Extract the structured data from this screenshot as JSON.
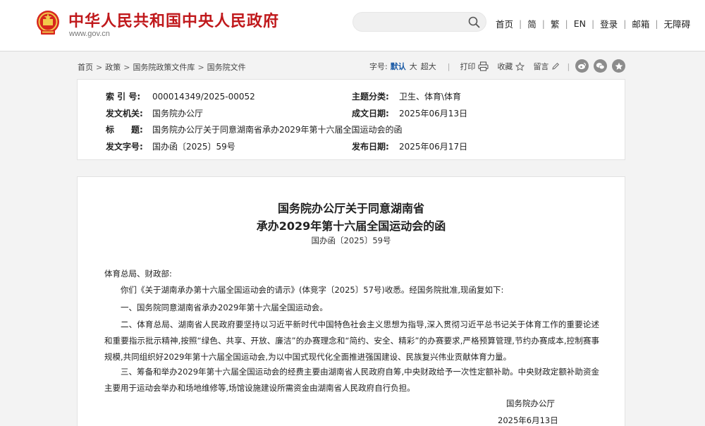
{
  "header": {
    "site_title": "中华人民共和国中央人民政府",
    "site_url": "www.gov.cn",
    "search_placeholder": "",
    "nav": [
      "首页",
      "简",
      "繁",
      "EN",
      "登录",
      "邮箱",
      "无障碍"
    ]
  },
  "breadcrumb": [
    "首页",
    "政策",
    "国务院政策文件库",
    "国务院文件"
  ],
  "tools": {
    "font_label": "字号:",
    "font_sizes": [
      "默认",
      "大",
      "超大"
    ],
    "print": "打印",
    "favorite": "收藏",
    "comment": "留言"
  },
  "colors": {
    "brand_red": "#c0191c",
    "active_blue": "#1a5aa6"
  },
  "info": {
    "index_label": "索 引 号:",
    "index_value": "000014349/2025-00052",
    "topic_label": "主题分类:",
    "topic_value": "卫生、体育\\体育",
    "issuer_label": "发文机关:",
    "issuer_value": "国务院办公厅",
    "date_label": "成文日期:",
    "date_value": "2025年06月13日",
    "title_label": "标　　题:",
    "title_value": "国务院办公厅关于同意湖南省承办2029年第十六届全国运动会的函",
    "docno_label": "发文字号:",
    "docno_value": "国办函〔2025〕59号",
    "pub_label": "发布日期:",
    "pub_value": "2025年06月17日"
  },
  "doc": {
    "title_line1": "国务院办公厅关于同意湖南省",
    "title_line2": "承办2029年第十六届全国运动会的函",
    "doc_no": "国办函〔2025〕59号",
    "salutation": "体育总局、财政部:",
    "p1": "你们《关于湖南承办第十六届全国运动会的请示》(体竞字〔2025〕57号)收悉。经国务院批准,现函复如下:",
    "p2": "一、国务院同意湖南省承办2029年第十六届全国运动会。",
    "p3": "二、体育总局、湖南省人民政府要坚持以习近平新时代中国特色社会主义思想为指导,深入贯彻习近平总书记关于体育工作的重要论述和重要指示批示精神,按照“绿色、共享、开放、廉洁”的办赛理念和“简约、安全、精彩”的办赛要求,严格预算管理,节约办赛成本,控制赛事规模,共同组织好2029年第十六届全国运动会,为以中国式现代化全面推进强国建设、民族复兴伟业贡献体育力量。",
    "p4": "三、筹备和举办2029年第十六届全国运动会的经费主要由湖南省人民政府自筹,中央财政给予一次性定额补助。中央财政定额补助资金主要用于运动会举办和场地维修等,场馆设施建设所需资金由湖南省人民政府自行负担。",
    "sign_org": "国务院办公厅",
    "sign_date": "2025年6月13日"
  }
}
